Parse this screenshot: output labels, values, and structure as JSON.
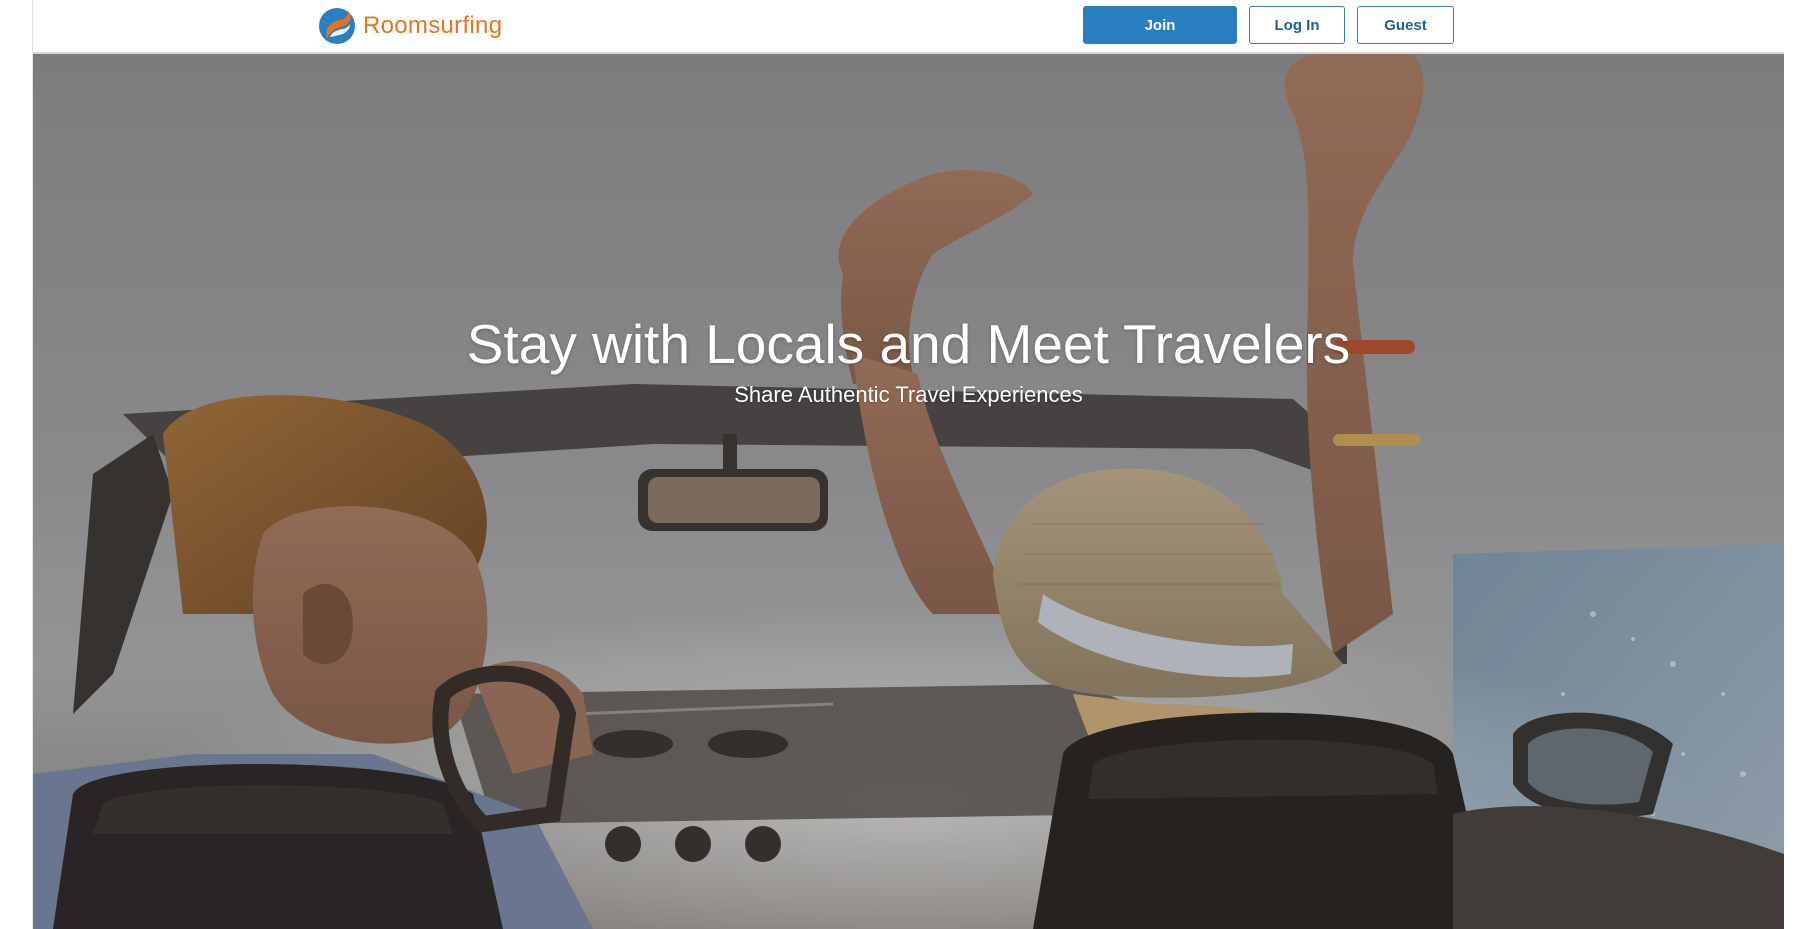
{
  "brand": {
    "name": "Roomsurfing",
    "logo_icon": "roomsurfing-logo-icon",
    "accent_color": "#e8721c",
    "logo_blue": "#2a7fc1"
  },
  "nav": {
    "join_label": "Join",
    "login_label": "Log In",
    "guest_label": "Guest",
    "primary_color": "#2a7fc1"
  },
  "hero": {
    "title": "Stay with Locals and Meet Travelers",
    "subtitle": "Share Authentic Travel Experiences",
    "background_image": "couple-in-convertible-photo"
  }
}
